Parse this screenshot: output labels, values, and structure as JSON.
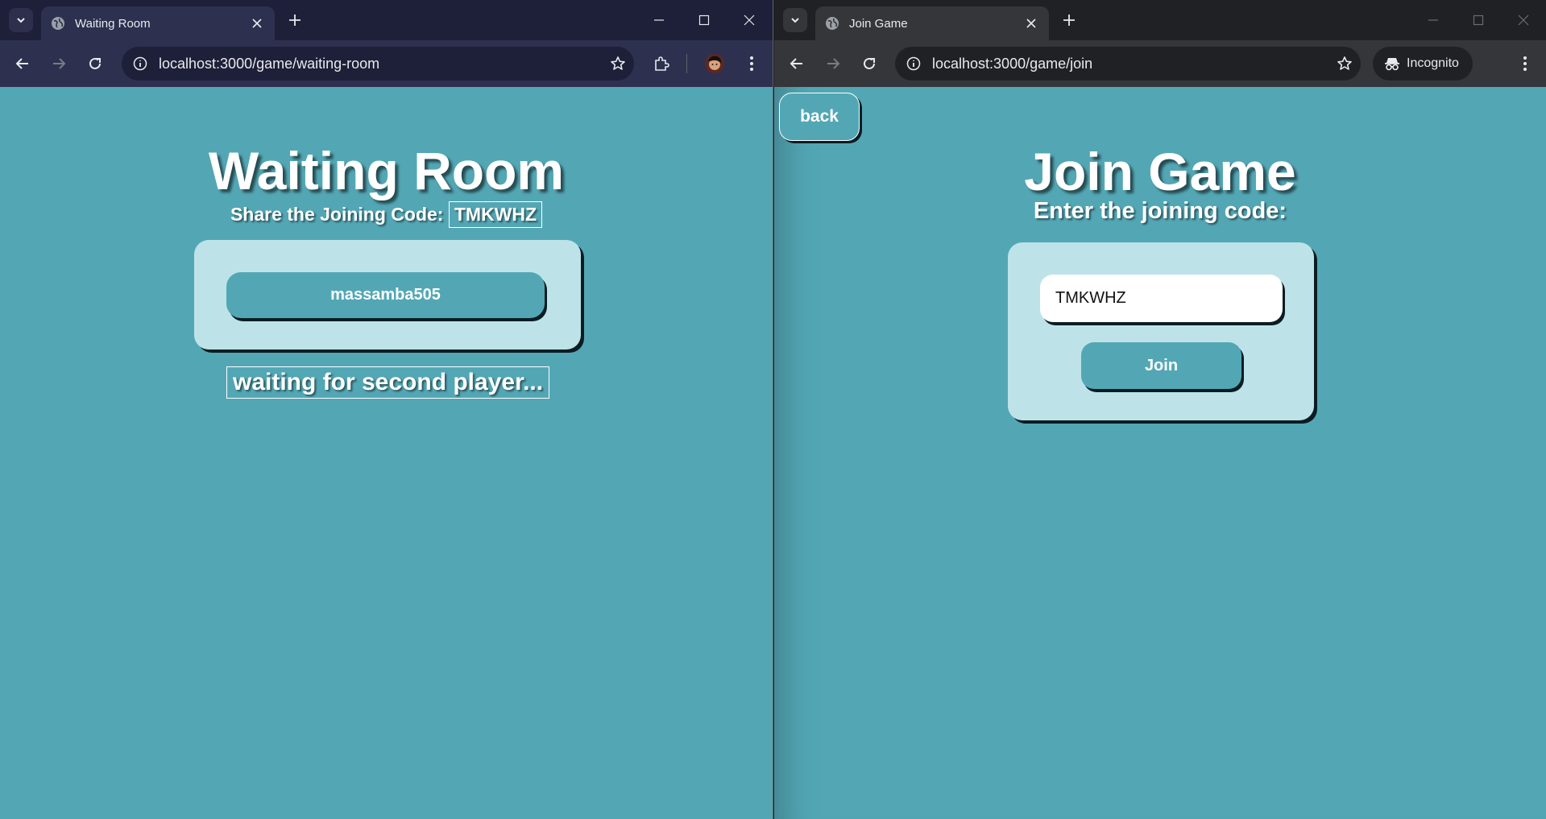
{
  "left_window": {
    "tab_title": "Waiting Room",
    "url": "localhost:3000/game/waiting-room",
    "page": {
      "title": "Waiting Room",
      "share_label": "Share the Joining Code:",
      "joining_code": "TMKWHZ",
      "players": [
        "massamba505"
      ],
      "status": "waiting for second player..."
    }
  },
  "right_window": {
    "tab_title": "Join Game",
    "url": "localhost:3000/game/join",
    "incognito_label": "Incognito",
    "page": {
      "back_label": "back",
      "title": "Join Game",
      "subtitle": "Enter the joining code:",
      "code_value": "TMKWHZ",
      "join_label": "Join"
    }
  },
  "colors": {
    "page_background": "#53a7b5",
    "card_background": "#bde3e8",
    "card_shadow": "#0b1d23"
  },
  "icons": [
    "tab-search-chevron-icon",
    "globe-icon",
    "close-icon",
    "new-tab-icon",
    "minimize-icon",
    "maximize-icon",
    "window-close-icon",
    "back-arrow-icon",
    "forward-arrow-icon",
    "reload-icon",
    "site-info-icon",
    "bookmark-star-icon",
    "extensions-icon",
    "profile-avatar",
    "kebab-menu-icon",
    "incognito-icon"
  ]
}
